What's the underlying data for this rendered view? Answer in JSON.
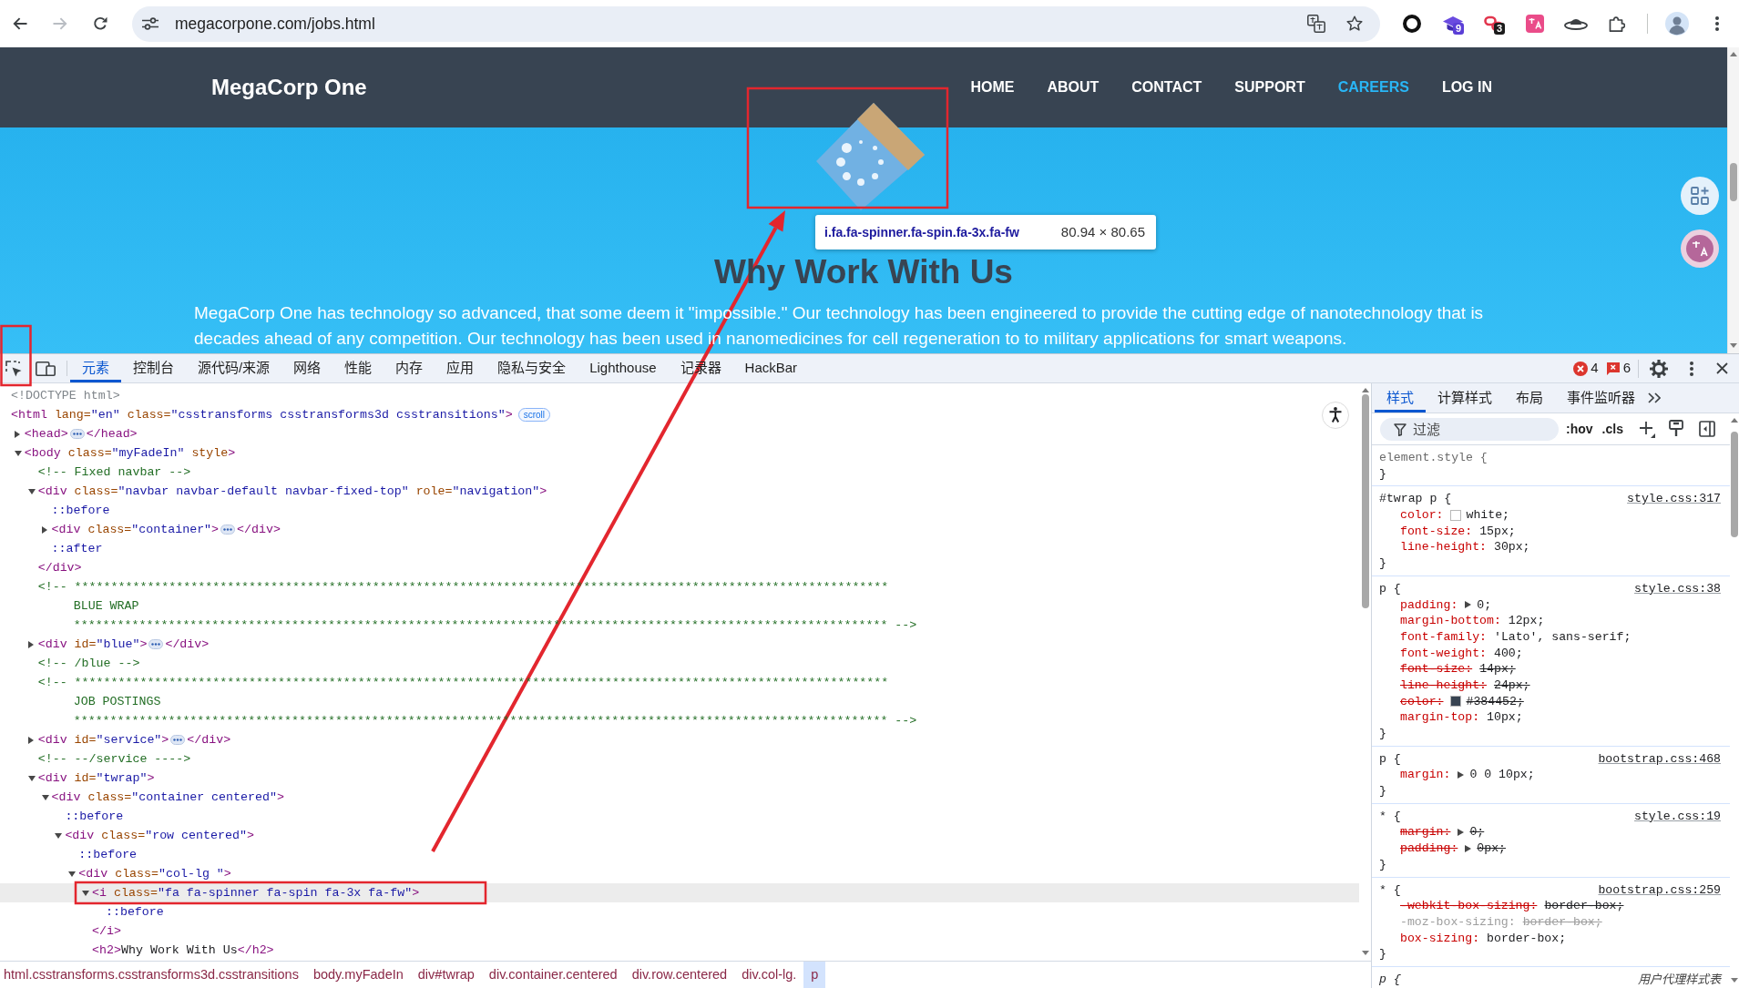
{
  "browser": {
    "nav_buttons": [
      {
        "kind": "back",
        "disabled": false
      },
      {
        "kind": "forward",
        "disabled": true
      },
      {
        "kind": "reload",
        "disabled": false
      }
    ],
    "url": "megacorpone.com/jobs.html",
    "extensions": [
      {
        "kind": "ring"
      },
      {
        "kind": "cap",
        "badge": "9"
      },
      {
        "kind": "link",
        "badge": "3"
      },
      {
        "kind": "translate"
      },
      {
        "kind": "saucer"
      },
      {
        "kind": "puzzle"
      }
    ]
  },
  "page": {
    "brand": "MegaCorp One",
    "nav": [
      {
        "label": "HOME",
        "selected": false
      },
      {
        "label": "ABOUT",
        "selected": false
      },
      {
        "label": "CONTACT",
        "selected": false
      },
      {
        "label": "SUPPORT",
        "selected": false
      },
      {
        "label": "CAREERS",
        "selected": true
      },
      {
        "label": "LOG IN",
        "selected": false
      }
    ],
    "heading": "Why Work With Us",
    "paragraph": "MegaCorp One has technology so advanced, that some deem it \"impossible.\" Our technology has been engineered to provide the cutting edge of nanotechnology that is decades ahead of any competition. Our technology has been used in nanomedicines for cell regeneration to to military applications for smart weapons.",
    "inspect_tooltip": {
      "selector": "i.fa.fa-spinner.fa-spin.fa-3x.fa-fw",
      "size": "80.94 × 80.65"
    },
    "side_buttons": [
      {
        "kind": "apps"
      },
      {
        "kind": "translate"
      }
    ]
  },
  "devtools": {
    "tabs": [
      {
        "label": "元素",
        "selected": true
      },
      {
        "label": "控制台",
        "selected": false
      },
      {
        "label": "源代码/来源",
        "selected": false
      },
      {
        "label": "网络",
        "selected": false
      },
      {
        "label": "性能",
        "selected": false
      },
      {
        "label": "内存",
        "selected": false
      },
      {
        "label": "应用",
        "selected": false
      },
      {
        "label": "隐私与安全",
        "selected": false
      },
      {
        "label": "Lighthouse",
        "selected": false
      },
      {
        "label": "记录器",
        "selected": false
      },
      {
        "label": "HackBar",
        "selected": false
      }
    ],
    "errors": "4",
    "issues": "6",
    "elements": {
      "nodes": [
        {
          "kind": "doctype",
          "text": "<!DOCTYPE html>",
          "selected": false
        },
        {
          "kind": "element",
          "tokens": [
            {
              "kind": "tag",
              "text": "<html"
            },
            {
              "kind": "attr",
              "text": " lang="
            },
            {
              "kind": "value",
              "text": "\"en\""
            },
            {
              "kind": "attr",
              "text": " class="
            },
            {
              "kind": "value",
              "text": "\"csstransforms csstransforms3d csstransitions\""
            },
            {
              "kind": "tag",
              "text": ">"
            }
          ],
          "badge": "scroll",
          "selected": false,
          "children": [
            {
              "kind": "element",
              "tokens": [
                {
                  "kind": "tag",
                  "text": "<head>"
                }
              ],
              "expanded": false,
              "close": "</head>",
              "selected": false
            },
            {
              "kind": "element",
              "tokens": [
                {
                  "kind": "tag",
                  "text": "<body"
                },
                {
                  "kind": "attr",
                  "text": " class="
                },
                {
                  "kind": "value",
                  "text": "\"myFadeIn\""
                },
                {
                  "kind": "attr",
                  "text": " style"
                },
                {
                  "kind": "tag",
                  "text": ">"
                }
              ],
              "expanded": true,
              "selected": false,
              "children": [
                {
                  "kind": "comment",
                  "lines": [
                    "<!-- Fixed navbar -->"
                  ],
                  "selected": false
                },
                {
                  "kind": "element",
                  "tokens": [
                    {
                      "kind": "tag",
                      "text": "<div"
                    },
                    {
                      "kind": "attr",
                      "text": " class="
                    },
                    {
                      "kind": "value",
                      "text": "\"navbar navbar-default navbar-fixed-top\""
                    },
                    {
                      "kind": "attr",
                      "text": " role="
                    },
                    {
                      "kind": "value",
                      "text": "\"navigation\""
                    },
                    {
                      "kind": "tag",
                      "text": ">"
                    }
                  ],
                  "expanded": true,
                  "selected": false,
                  "close": "</div>",
                  "children": [
                    {
                      "kind": "pseudo",
                      "text": "::before",
                      "selected": false
                    },
                    {
                      "kind": "element",
                      "tokens": [
                        {
                          "kind": "tag",
                          "text": "<div"
                        },
                        {
                          "kind": "attr",
                          "text": " class="
                        },
                        {
                          "kind": "value",
                          "text": "\"container\""
                        },
                        {
                          "kind": "tag",
                          "text": ">"
                        }
                      ],
                      "expanded": false,
                      "close": "</div>",
                      "selected": false
                    },
                    {
                      "kind": "pseudo",
                      "text": "::after",
                      "selected": false
                    }
                  ]
                },
                {
                  "kind": "comment",
                  "lines": [
                    "<!-- ****************************************************************************************************************",
                    "BLUE WRAP",
                    "**************************************************************************************************************** -->"
                  ],
                  "selected": false
                },
                {
                  "kind": "element",
                  "tokens": [
                    {
                      "kind": "tag",
                      "text": "<div"
                    },
                    {
                      "kind": "attr",
                      "text": " id="
                    },
                    {
                      "kind": "value",
                      "text": "\"blue\""
                    },
                    {
                      "kind": "tag",
                      "text": ">"
                    }
                  ],
                  "expanded": false,
                  "close": "</div>",
                  "selected": false
                },
                {
                  "kind": "comment",
                  "lines": [
                    "<!-- /blue -->"
                  ],
                  "selected": false
                },
                {
                  "kind": "comment",
                  "lines": [
                    "<!-- ****************************************************************************************************************",
                    "JOB POSTINGS",
                    "**************************************************************************************************************** -->"
                  ],
                  "selected": false
                },
                {
                  "kind": "element",
                  "tokens": [
                    {
                      "kind": "tag",
                      "text": "<div"
                    },
                    {
                      "kind": "attr",
                      "text": " id="
                    },
                    {
                      "kind": "value",
                      "text": "\"service\""
                    },
                    {
                      "kind": "tag",
                      "text": ">"
                    }
                  ],
                  "expanded": false,
                  "close": "</div>",
                  "selected": false
                },
                {
                  "kind": "comment",
                  "lines": [
                    "<!-- --/service ---->"
                  ],
                  "selected": false
                },
                {
                  "kind": "element",
                  "tokens": [
                    {
                      "kind": "tag",
                      "text": "<div"
                    },
                    {
                      "kind": "attr",
                      "text": " id="
                    },
                    {
                      "kind": "value",
                      "text": "\"twrap\""
                    },
                    {
                      "kind": "tag",
                      "text": ">"
                    }
                  ],
                  "expanded": true,
                  "selected": false,
                  "children": [
                    {
                      "kind": "element",
                      "tokens": [
                        {
                          "kind": "tag",
                          "text": "<div"
                        },
                        {
                          "kind": "attr",
                          "text": " class="
                        },
                        {
                          "kind": "value",
                          "text": "\"container centered\""
                        },
                        {
                          "kind": "tag",
                          "text": ">"
                        }
                      ],
                      "expanded": true,
                      "selected": false,
                      "children": [
                        {
                          "kind": "pseudo",
                          "text": "::before",
                          "selected": false
                        },
                        {
                          "kind": "element",
                          "tokens": [
                            {
                              "kind": "tag",
                              "text": "<div"
                            },
                            {
                              "kind": "attr",
                              "text": " class="
                            },
                            {
                              "kind": "value",
                              "text": "\"row centered\""
                            },
                            {
                              "kind": "tag",
                              "text": ">"
                            }
                          ],
                          "expanded": true,
                          "selected": false,
                          "children": [
                            {
                              "kind": "pseudo",
                              "text": "::before",
                              "selected": false
                            },
                            {
                              "kind": "element",
                              "tokens": [
                                {
                                  "kind": "tag",
                                  "text": "<div"
                                },
                                {
                                  "kind": "attr",
                                  "text": " class="
                                },
                                {
                                  "kind": "value",
                                  "text": "\"col-lg \""
                                },
                                {
                                  "kind": "tag",
                                  "text": ">"
                                }
                              ],
                              "expanded": true,
                              "selected": false,
                              "children": [
                                {
                                  "kind": "element",
                                  "tokens": [
                                    {
                                      "kind": "tag",
                                      "text": "<i"
                                    },
                                    {
                                      "kind": "attr",
                                      "text": " class="
                                    },
                                    {
                                      "kind": "value",
                                      "text": "\"fa fa-spinner fa-spin fa-3x fa-fw\""
                                    },
                                    {
                                      "kind": "tag",
                                      "text": ">"
                                    }
                                  ],
                                  "expanded": true,
                                  "selected": true,
                                  "close": "</i>",
                                  "children": [
                                    {
                                      "kind": "pseudo",
                                      "text": "::before",
                                      "selected": false
                                    }
                                  ]
                                },
                                {
                                  "kind": "element",
                                  "tokens": [
                                    {
                                      "kind": "tag",
                                      "text": "<h2>"
                                    },
                                    {
                                      "kind": "text",
                                      "text": "Why Work With Us"
                                    },
                                    {
                                      "kind": "tag",
                                      "text": "</h2>"
                                    }
                                  ],
                                  "selected": false
                                }
                              ]
                            }
                          ]
                        }
                      ]
                    }
                  ]
                }
              ]
            }
          ]
        }
      ]
    },
    "breadcrumbs": [
      {
        "label": "html.csstransforms.csstransforms3d.csstransitions",
        "selected": false
      },
      {
        "label": "body.myFadeIn",
        "selected": false
      },
      {
        "label": "div#twrap",
        "selected": false
      },
      {
        "label": "div.container.centered",
        "selected": false
      },
      {
        "label": "div.row.centered",
        "selected": false
      },
      {
        "label": "div.col-lg.",
        "selected": false
      },
      {
        "label": "p",
        "selected": true
      }
    ],
    "styles": {
      "tabs": [
        {
          "label": "样式",
          "selected": true
        },
        {
          "label": "计算样式",
          "selected": false
        },
        {
          "label": "布局",
          "selected": false
        },
        {
          "label": "事件监听器",
          "selected": false
        }
      ],
      "filter": {
        "placeholder": "过滤"
      },
      "toggles": [
        ":hov",
        ".cls"
      ],
      "rules": [
        {
          "kind": "inline",
          "selector": "element.style {",
          "close": "}"
        },
        {
          "kind": "author",
          "selector": "#twrap p {",
          "source": "style.css:317",
          "close": "}",
          "props": [
            {
              "name": "color:",
              "value": "white;",
              "overridden": false,
              "invalid": false,
              "shorthand": false,
              "color": "#ffffff"
            },
            {
              "name": "font-size:",
              "value": "15px;",
              "overridden": false,
              "invalid": false,
              "shorthand": false
            },
            {
              "name": "line-height:",
              "value": "30px;",
              "overridden": false,
              "invalid": false,
              "shorthand": false
            }
          ]
        },
        {
          "kind": "author",
          "selector": "p {",
          "source": "style.css:38",
          "close": "}",
          "props": [
            {
              "name": "padding:",
              "value": "0;",
              "overridden": false,
              "invalid": false,
              "shorthand": true
            },
            {
              "name": "margin-bottom:",
              "value": "12px;",
              "overridden": false,
              "invalid": false,
              "shorthand": false
            },
            {
              "name": "font-family:",
              "value": "'Lato', sans-serif;",
              "overridden": false,
              "invalid": false,
              "shorthand": false
            },
            {
              "name": "font-weight:",
              "value": "400;",
              "overridden": false,
              "invalid": false,
              "shorthand": false
            },
            {
              "name": "font-size:",
              "value": "14px;",
              "overridden": true,
              "invalid": false,
              "shorthand": false
            },
            {
              "name": "line-height:",
              "value": "24px;",
              "overridden": true,
              "invalid": false,
              "shorthand": false
            },
            {
              "name": "color:",
              "value": "#384452;",
              "overridden": true,
              "invalid": false,
              "shorthand": false,
              "color": "#384452"
            },
            {
              "name": "margin-top:",
              "value": "10px;",
              "overridden": false,
              "invalid": false,
              "shorthand": false
            }
          ]
        },
        {
          "kind": "author",
          "selector": "p {",
          "source": "bootstrap.css:468",
          "close": "}",
          "props": [
            {
              "name": "margin:",
              "value": "0 0 10px;",
              "overridden": false,
              "invalid": false,
              "shorthand": true
            }
          ]
        },
        {
          "kind": "author",
          "selector": "* {",
          "source": "style.css:19",
          "close": "}",
          "props": [
            {
              "name": "margin:",
              "value": "0;",
              "overridden": true,
              "invalid": false,
              "shorthand": true
            },
            {
              "name": "padding:",
              "value": "0px;",
              "overridden": true,
              "invalid": false,
              "shorthand": true
            }
          ]
        },
        {
          "kind": "author",
          "selector": "* {",
          "source": "bootstrap.css:259",
          "close": "}",
          "props": [
            {
              "name": "-webkit-box-sizing:",
              "value": "border-box;",
              "overridden": true,
              "invalid": false,
              "shorthand": false
            },
            {
              "name": "-moz-box-sizing:",
              "value": "border-box;",
              "overridden": false,
              "invalid": true,
              "shorthand": false
            },
            {
              "name": "box-sizing:",
              "value": "border-box;",
              "overridden": false,
              "invalid": false,
              "shorthand": false
            }
          ]
        },
        {
          "kind": "user-agent",
          "selector": "p {",
          "source": "用户代理样式表"
        }
      ]
    }
  }
}
